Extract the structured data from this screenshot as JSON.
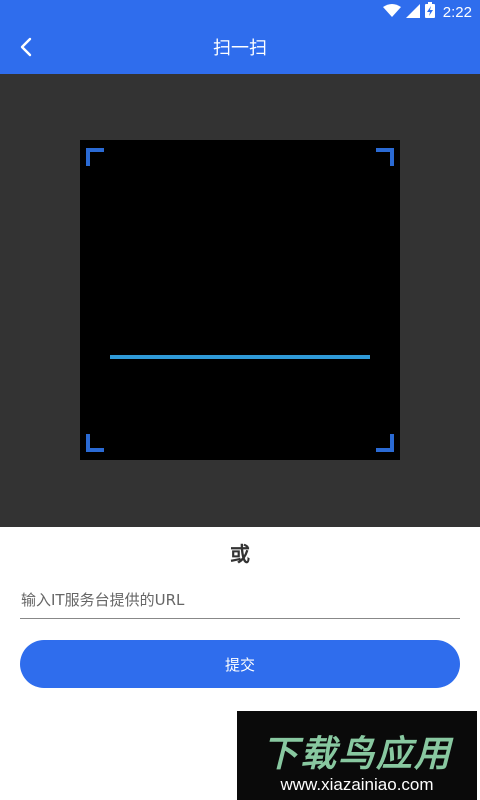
{
  "status_bar": {
    "time": "2:22"
  },
  "app_bar": {
    "title": "扫一扫"
  },
  "scanner": {
    "divider_text": "或"
  },
  "url_form": {
    "placeholder": "输入IT服务台提供的URL",
    "value": "",
    "submit_label": "提交"
  },
  "watermark": {
    "brand": "下载鸟应用",
    "url": "www.xiazainiao.com"
  },
  "colors": {
    "primary": "#2f6ded",
    "scan_bg": "#333333",
    "viewfinder": "#000000",
    "scan_line": "#2f9ad8",
    "corner": "#2a6ad4"
  }
}
